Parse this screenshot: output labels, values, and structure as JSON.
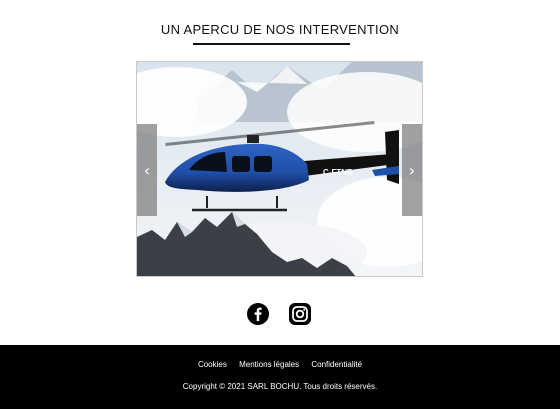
{
  "section": {
    "title": "UN APERCU DE NOS INTERVENTION"
  },
  "carousel": {
    "prev_icon": "chevron-left-icon",
    "next_icon": "chevron-right-icon",
    "prev_glyph": "‹",
    "next_glyph": "›",
    "slide_registration": "C-FTNB"
  },
  "social": {
    "facebook_icon": "facebook-icon",
    "instagram_icon": "instagram-icon"
  },
  "footer": {
    "links": [
      "Cookies",
      "Mentions légales",
      "Confidentialité"
    ],
    "copyright": "Copyright © 2021 SARL BOCHU. Tous droits réservés."
  },
  "colors": {
    "footer_bg": "#000000",
    "helicopter_blue": "#1f4fa8"
  }
}
